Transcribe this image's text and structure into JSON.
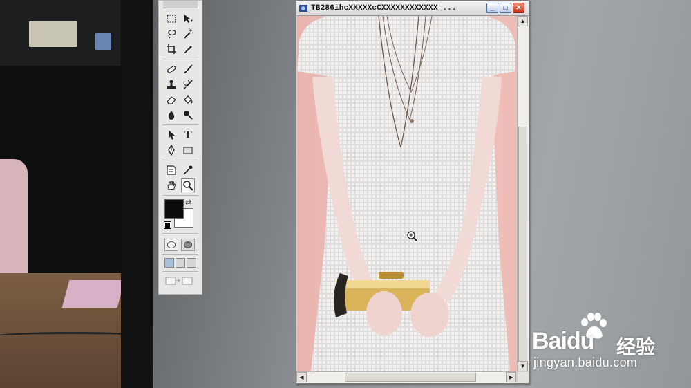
{
  "window": {
    "title": "TB286ihcXXXXXcCXXXXXXXXXXXX_...",
    "minimize_icon": "minimize-icon",
    "maximize_icon": "maximize-icon",
    "close_icon": "close-icon"
  },
  "toolbox": {
    "tools": [
      "marquee-icon",
      "move-icon",
      "lasso-icon",
      "magic-wand-icon",
      "crop-icon",
      "slice-icon",
      "healing-brush-icon",
      "brush-icon",
      "clone-stamp-icon",
      "history-brush-icon",
      "eraser-icon",
      "paint-bucket-icon",
      "blur-icon",
      "dodge-icon",
      "path-selection-icon",
      "type-icon",
      "pen-icon",
      "rectangle-icon",
      "notes-icon",
      "eyedropper-icon",
      "hand-icon",
      "zoom-icon"
    ],
    "type_tool_glyph": "T",
    "selected_tool": "zoom-icon",
    "foreground_color": "#0b0b0b",
    "background_color": "#ffffff"
  },
  "scrollbar": {
    "up_glyph": "▲",
    "down_glyph": "▼",
    "left_glyph": "◀",
    "right_glyph": "▶"
  },
  "watermark": {
    "brand": "Baidu",
    "brand_cn": "经验",
    "url": "jingyan.baidu.com"
  },
  "colors": {
    "canvas_bg": "#eebcb5",
    "window_close": "#c5331b",
    "toolbox_bg": "#e7e7e5"
  }
}
